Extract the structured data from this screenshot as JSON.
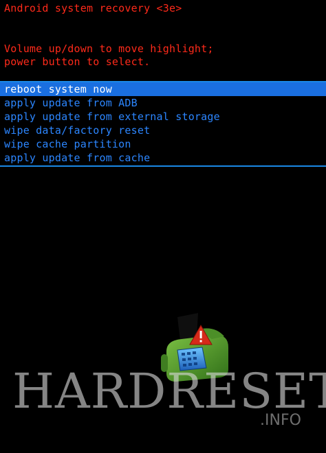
{
  "recovery": {
    "title": "Android system recovery <3e>",
    "instructions": [
      "Volume up/down to move highlight;",
      "power button to select."
    ],
    "menu": [
      {
        "label": "reboot system now",
        "selected": true
      },
      {
        "label": "apply update from ADB",
        "selected": false
      },
      {
        "label": "apply update from external storage",
        "selected": false
      },
      {
        "label": "wipe data/factory reset",
        "selected": false
      },
      {
        "label": "wipe cache partition",
        "selected": false
      },
      {
        "label": "apply update from cache",
        "selected": false
      }
    ]
  },
  "watermark": {
    "brand": "HARDRESET",
    "suffix": ".INFO"
  },
  "icons": {
    "robot": "android-robot-warning-icon"
  },
  "colors": {
    "header_text": "#ff2a1a",
    "menu_text": "#2c86ff",
    "selection_bg": "#1a6fe0",
    "background": "#000000"
  }
}
